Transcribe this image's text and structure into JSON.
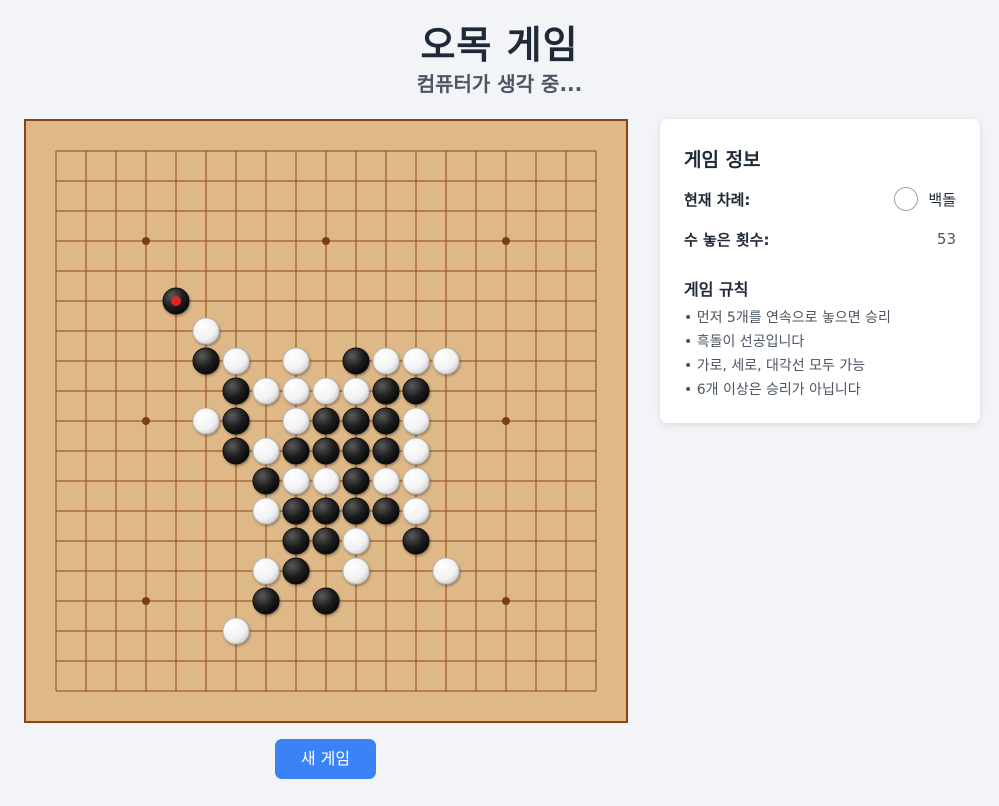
{
  "header": {
    "title": "오목 게임",
    "status": "컴퓨터가 생각 중..."
  },
  "board": {
    "size": 19,
    "star_points": [
      [
        3,
        3
      ],
      [
        3,
        9
      ],
      [
        3,
        15
      ],
      [
        9,
        3
      ],
      [
        9,
        15
      ],
      [
        15,
        3
      ],
      [
        15,
        9
      ],
      [
        15,
        15
      ]
    ],
    "last_move": [
      5,
      4
    ],
    "stones": [
      {
        "row": 5,
        "col": 4,
        "color": "black"
      },
      {
        "row": 6,
        "col": 5,
        "color": "white"
      },
      {
        "row": 7,
        "col": 5,
        "color": "black"
      },
      {
        "row": 7,
        "col": 6,
        "color": "white"
      },
      {
        "row": 7,
        "col": 8,
        "color": "white"
      },
      {
        "row": 7,
        "col": 10,
        "color": "black"
      },
      {
        "row": 7,
        "col": 11,
        "color": "white"
      },
      {
        "row": 7,
        "col": 12,
        "color": "white"
      },
      {
        "row": 7,
        "col": 13,
        "color": "white"
      },
      {
        "row": 8,
        "col": 6,
        "color": "black"
      },
      {
        "row": 8,
        "col": 7,
        "color": "white"
      },
      {
        "row": 8,
        "col": 8,
        "color": "white"
      },
      {
        "row": 8,
        "col": 9,
        "color": "white"
      },
      {
        "row": 8,
        "col": 10,
        "color": "white"
      },
      {
        "row": 8,
        "col": 11,
        "color": "black"
      },
      {
        "row": 8,
        "col": 12,
        "color": "black"
      },
      {
        "row": 9,
        "col": 5,
        "color": "white"
      },
      {
        "row": 9,
        "col": 6,
        "color": "black"
      },
      {
        "row": 9,
        "col": 8,
        "color": "white"
      },
      {
        "row": 9,
        "col": 9,
        "color": "black"
      },
      {
        "row": 9,
        "col": 10,
        "color": "black"
      },
      {
        "row": 9,
        "col": 11,
        "color": "black"
      },
      {
        "row": 9,
        "col": 12,
        "color": "white"
      },
      {
        "row": 10,
        "col": 6,
        "color": "black"
      },
      {
        "row": 10,
        "col": 7,
        "color": "white"
      },
      {
        "row": 10,
        "col": 8,
        "color": "black"
      },
      {
        "row": 10,
        "col": 9,
        "color": "black"
      },
      {
        "row": 10,
        "col": 10,
        "color": "black"
      },
      {
        "row": 10,
        "col": 11,
        "color": "black"
      },
      {
        "row": 10,
        "col": 12,
        "color": "white"
      },
      {
        "row": 11,
        "col": 7,
        "color": "black"
      },
      {
        "row": 11,
        "col": 8,
        "color": "white"
      },
      {
        "row": 11,
        "col": 9,
        "color": "white"
      },
      {
        "row": 11,
        "col": 10,
        "color": "black"
      },
      {
        "row": 11,
        "col": 11,
        "color": "white"
      },
      {
        "row": 11,
        "col": 12,
        "color": "white"
      },
      {
        "row": 12,
        "col": 7,
        "color": "white"
      },
      {
        "row": 12,
        "col": 8,
        "color": "black"
      },
      {
        "row": 12,
        "col": 9,
        "color": "black"
      },
      {
        "row": 12,
        "col": 10,
        "color": "black"
      },
      {
        "row": 12,
        "col": 11,
        "color": "black"
      },
      {
        "row": 12,
        "col": 12,
        "color": "white"
      },
      {
        "row": 13,
        "col": 8,
        "color": "black"
      },
      {
        "row": 13,
        "col": 9,
        "color": "black"
      },
      {
        "row": 13,
        "col": 10,
        "color": "white"
      },
      {
        "row": 13,
        "col": 12,
        "color": "black"
      },
      {
        "row": 14,
        "col": 7,
        "color": "white"
      },
      {
        "row": 14,
        "col": 8,
        "color": "black"
      },
      {
        "row": 14,
        "col": 10,
        "color": "white"
      },
      {
        "row": 14,
        "col": 13,
        "color": "white"
      },
      {
        "row": 15,
        "col": 7,
        "color": "black"
      },
      {
        "row": 15,
        "col": 9,
        "color": "black"
      },
      {
        "row": 16,
        "col": 6,
        "color": "white"
      }
    ]
  },
  "buttons": {
    "new_game": "새 게임"
  },
  "info": {
    "title": "게임 정보",
    "turn_label": "현재 차례:",
    "turn_value": "백돌",
    "moves_label": "수 놓은 횟수:",
    "moves_value": "53",
    "rules_title": "게임 규칙",
    "rules": [
      "먼저 5개를 연속으로 놓으면 승리",
      "흑돌이 선공입니다",
      "가로, 세로, 대각선 모두 가능",
      "6개 이상은 승리가 아닙니다"
    ]
  },
  "colors": {
    "board_bg": "#deb887",
    "board_line": "#8b4513",
    "accent": "#3b82f6",
    "last_move_marker": "#dc2626"
  }
}
